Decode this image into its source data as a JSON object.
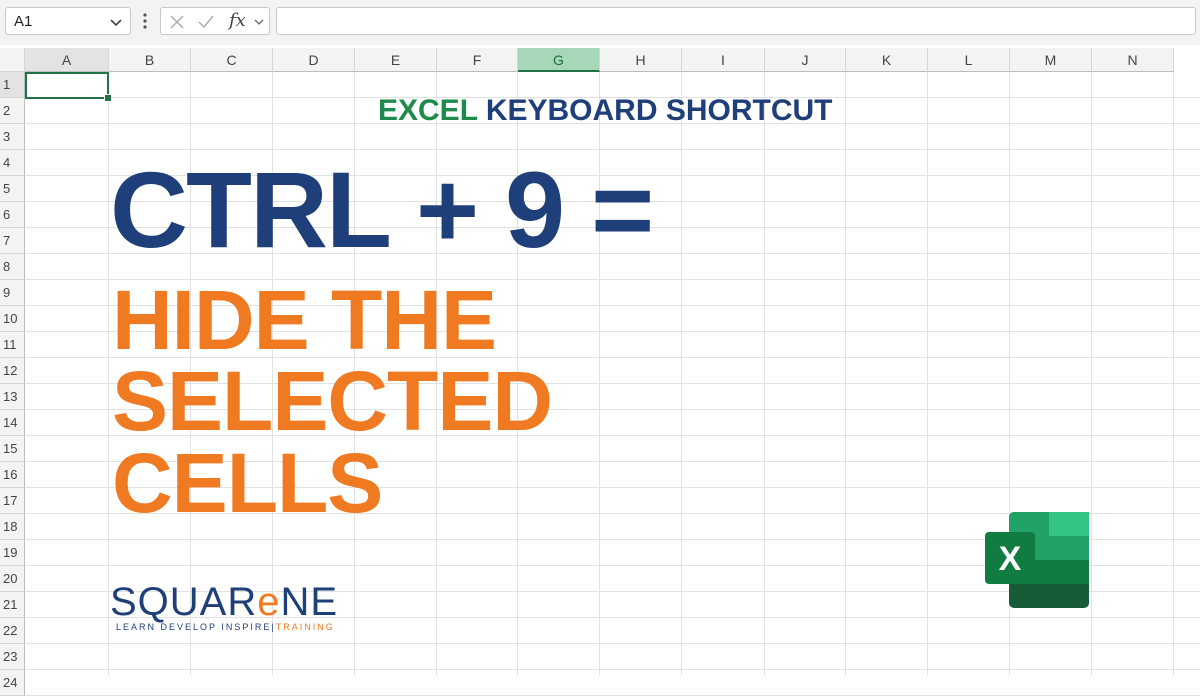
{
  "formula_bar": {
    "name_box_value": "A1",
    "fx_label": "fx",
    "formula_value": ""
  },
  "sheet": {
    "columns": [
      "A",
      "B",
      "C",
      "D",
      "E",
      "F",
      "G",
      "H",
      "I",
      "J",
      "K",
      "L",
      "M",
      "N"
    ],
    "selected_column": "G",
    "active_cell": "A1",
    "rows": [
      "1",
      "2",
      "3",
      "4",
      "5",
      "6",
      "7",
      "8",
      "9",
      "10",
      "11",
      "12",
      "13",
      "14",
      "15",
      "16",
      "17",
      "18",
      "19",
      "20",
      "21",
      "22",
      "23",
      "24"
    ]
  },
  "content": {
    "subtitle_green": "EXCEL",
    "subtitle_blue": " KEYBOARD SHORTCUT",
    "shortcut": "CTRL + 9 =",
    "description_lines": [
      "HIDE THE",
      "SELECTED",
      "CELLS"
    ]
  },
  "logo": {
    "brand_prefix": "SQUAR",
    "brand_e": "e",
    "brand_suffix": "NE",
    "tagline_main": "LEARN DEVELOP INSPIRE",
    "tagline_sep": "|",
    "tagline_accent": "TRAINING"
  },
  "excel_icon": {
    "letter": "X"
  },
  "colors": {
    "excel_green": "#217346",
    "brand_blue": "#1f3f7a",
    "brand_orange": "#f07a22",
    "subtitle_green": "#1e8a4c"
  }
}
